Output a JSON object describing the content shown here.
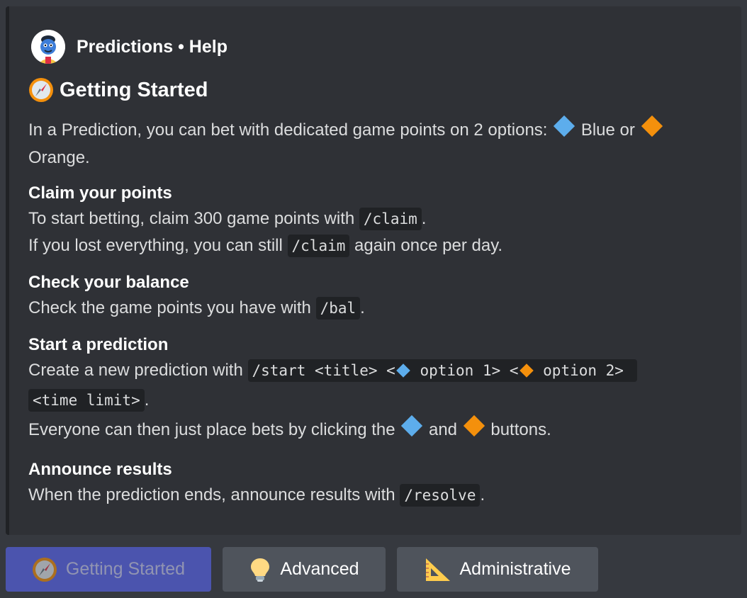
{
  "author": {
    "name": "Predictions • Help"
  },
  "embed": {
    "title": "Getting Started",
    "description": {
      "pre": "In a Prediction, you can bet with dedicated game points on 2 options: ",
      "blue": "Blue or",
      "orange": "Orange."
    },
    "fields": {
      "claim": {
        "name": "Claim your points",
        "l1_pre": "To start betting, claim 300 game points with ",
        "l1_code": "/claim",
        "l1_post": ".",
        "l2_pre": "If you lost everything, you can still ",
        "l2_code": "/claim",
        "l2_post": " again once per day."
      },
      "balance": {
        "name": "Check your balance",
        "pre": "Check the game points you have with ",
        "code": "/bal",
        "post": "."
      },
      "start": {
        "name": "Start a prediction",
        "pre": "Create a new prediction with ",
        "code_a": "/start <title> <",
        "code_b": " option 1> <",
        "code_c": " option 2> ",
        "code_d": "<time limit>",
        "post": ".",
        "l2_pre": "Everyone can then just place bets by clicking the ",
        "l2_and": " and ",
        "l2_post": " buttons."
      },
      "announce": {
        "name": "Announce results",
        "pre": "When the prediction ends, announce results with ",
        "code": "/resolve",
        "post": "."
      }
    }
  },
  "buttons": {
    "getting_started": "Getting Started",
    "advanced": "Advanced",
    "administrative": "Administrative"
  },
  "colors": {
    "blue_option": "#5dadec",
    "orange_option": "#f4900c",
    "primary_button": "#5865f2"
  }
}
